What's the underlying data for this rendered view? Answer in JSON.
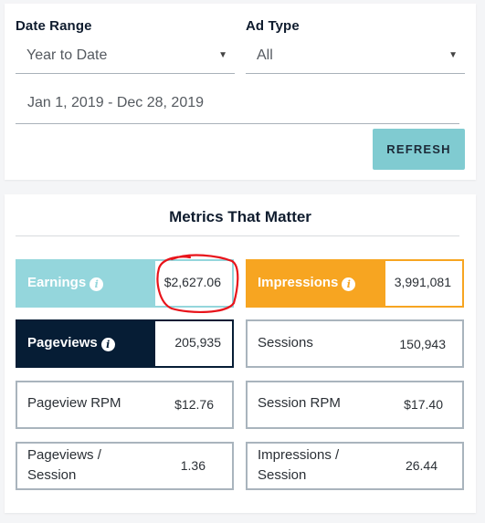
{
  "filters": {
    "date_range_label": "Date Range",
    "date_range_value": "Year to Date",
    "ad_type_label": "Ad Type",
    "ad_type_value": "All",
    "date_input_value": "Jan 1, 2019 - Dec 28, 2019",
    "refresh_label": "REFRESH",
    "caret": "▼"
  },
  "metrics": {
    "title": "Metrics That Matter",
    "info_glyph": "i",
    "tiles": [
      {
        "label": "Earnings",
        "value": "$2,627.06",
        "color": "#94d6dc",
        "highlighted": true,
        "info": true
      },
      {
        "label": "Impressions",
        "value": "3,991,081",
        "color": "#f7a521",
        "highlighted": true,
        "info": true
      },
      {
        "label": "Pageviews",
        "value": "205,935",
        "color": "#061d35",
        "highlighted": true,
        "info": true
      },
      {
        "label": "Sessions",
        "value": "150,943",
        "highlighted": false
      },
      {
        "label": "Pageview RPM",
        "value": "$12.76",
        "highlighted": false
      },
      {
        "label": "Session RPM",
        "value": "$17.40",
        "highlighted": false
      },
      {
        "label_line1": "Pageviews /",
        "label_line2": "Session",
        "value": "1.36",
        "highlighted": false
      },
      {
        "label_line1": "Impressions /",
        "label_line2": "Session",
        "value": "26.44",
        "highlighted": false
      }
    ]
  },
  "annotation": {
    "color": "#e8141b",
    "target": "earnings-value"
  }
}
